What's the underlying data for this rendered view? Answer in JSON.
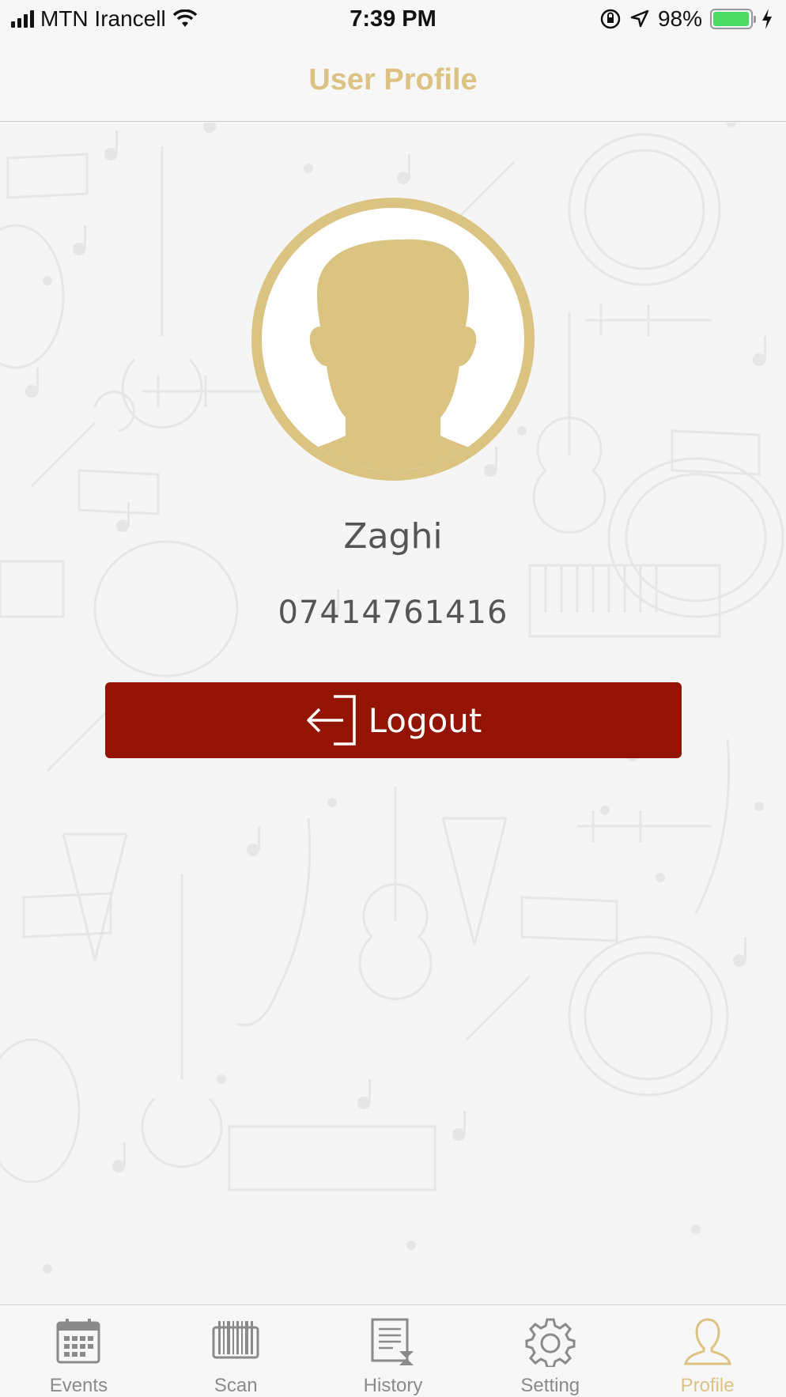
{
  "status_bar": {
    "carrier": "MTN Irancell",
    "time": "7:39 PM",
    "battery": "98%",
    "battery_level": 0.98
  },
  "nav": {
    "title": "User Profile"
  },
  "profile": {
    "name": "Zaghi",
    "phone": "07414761416",
    "logout_label": "Logout"
  },
  "tabs": [
    {
      "label": "Events",
      "icon": "calendar-icon"
    },
    {
      "label": "Scan",
      "icon": "barcode-icon"
    },
    {
      "label": "History",
      "icon": "history-icon"
    },
    {
      "label": "Setting",
      "icon": "gear-icon"
    },
    {
      "label": "Profile",
      "icon": "person-icon",
      "active": true
    }
  ],
  "colors": {
    "accent": "#dcc384",
    "logout": "#931402",
    "tab_inactive": "#8a8a8a",
    "battery": "#4cd964"
  }
}
